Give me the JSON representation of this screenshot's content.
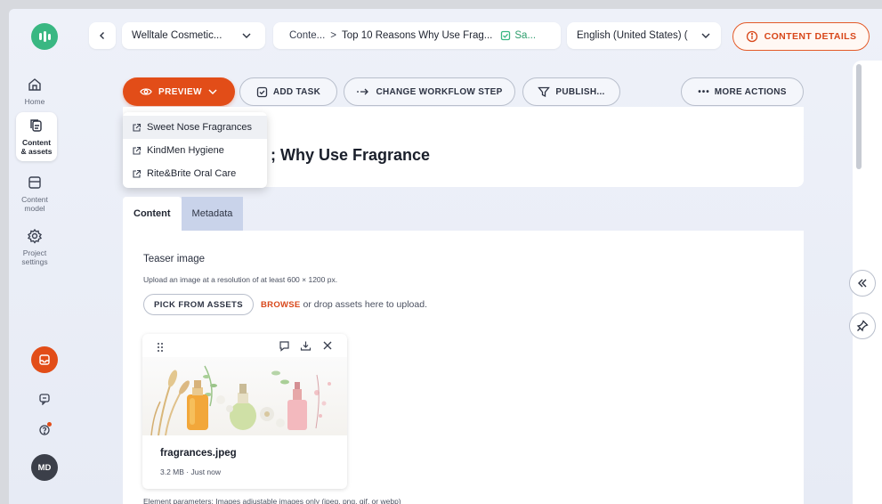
{
  "rail": {
    "items": [
      {
        "label": "Home"
      },
      {
        "label": "Content\n& assets"
      },
      {
        "label": "Content\nmodel"
      },
      {
        "label": "Project\nsettings"
      }
    ],
    "avatar": "MD"
  },
  "topbar": {
    "project": "Welltale Cosmetic...",
    "breadcrumb_root": "Conte...",
    "breadcrumb_sep": ">",
    "breadcrumb_item": "Top 10 Reasons Why Use Frag...",
    "status": "Sa...",
    "language": "English (United States) (",
    "content_details": "CONTENT DETAILS"
  },
  "actions": {
    "preview": "PREVIEW",
    "add_task": "ADD TASK",
    "change_workflow": "CHANGE WORKFLOW STEP",
    "publish": "PUBLISH...",
    "more_actions": "MORE ACTIONS"
  },
  "preview_menu": [
    "Sweet Nose Fragrances",
    "KindMen Hygiene",
    "Rite&Brite Oral Care"
  ],
  "title": "; Why Use Fragrance",
  "tabs": [
    "Content",
    "Metadata"
  ],
  "teaser": {
    "label": "Teaser image",
    "hint": "Upload an image at a resolution of at least 600 × 1200 px.",
    "pick_button": "PICK FROM ASSETS",
    "browse": "BROWSE",
    "browse_rest": " or drop assets here to upload."
  },
  "asset": {
    "filename": "fragrances.jpeg",
    "meta": "3.2 MB · Just now"
  },
  "element_parameters": "Element parameters: Images adjustable images only (jpeg, png, gif, or webp)",
  "colors": {
    "accent": "#e24d18",
    "brand": "#39b782"
  }
}
